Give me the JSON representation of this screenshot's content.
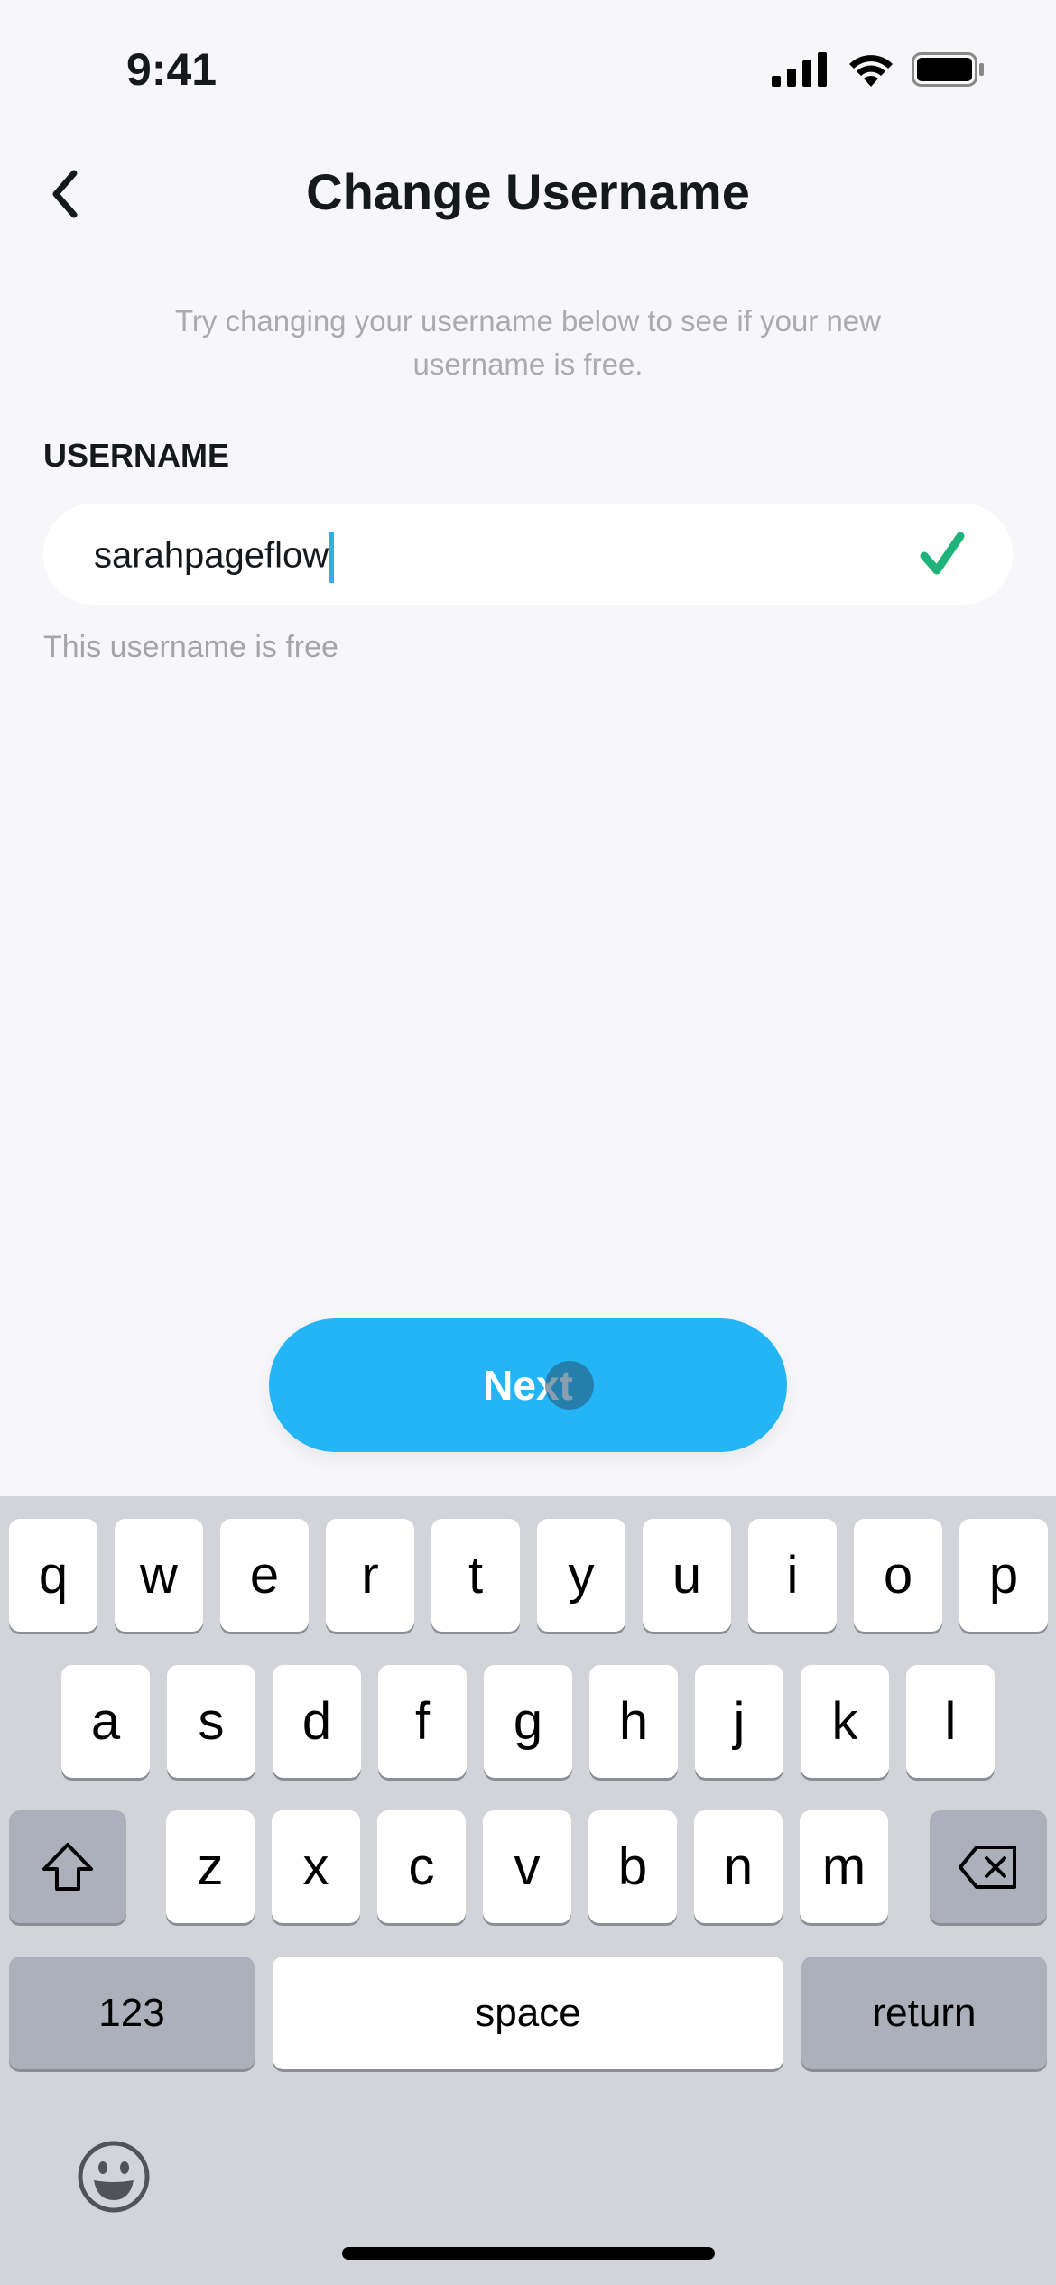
{
  "status_bar": {
    "time": "9:41",
    "icons": [
      "cellular-signal-icon",
      "wifi-icon",
      "battery-icon"
    ]
  },
  "header": {
    "title": "Change Username",
    "back_icon": "chevron-left-icon"
  },
  "subtitle": "Try changing your username below to see if your new username is free.",
  "username": {
    "label": "USERNAME",
    "value": "sarahpageflow",
    "status_icon": "checkmark-icon",
    "status_color": "#1fb27a",
    "helper": "This username is free"
  },
  "next_button": {
    "label": "Next",
    "color": "#23b5f5"
  },
  "keyboard": {
    "row1": [
      "q",
      "w",
      "e",
      "r",
      "t",
      "y",
      "u",
      "i",
      "o",
      "p"
    ],
    "row2": [
      "a",
      "s",
      "d",
      "f",
      "g",
      "h",
      "j",
      "k",
      "l"
    ],
    "row3": [
      "z",
      "x",
      "c",
      "v",
      "b",
      "n",
      "m"
    ],
    "numbers_label": "123",
    "space_label": "space",
    "return_label": "return",
    "shift_icon": "shift-icon",
    "delete_icon": "delete-icon",
    "emoji_icon": "emoji-icon"
  }
}
